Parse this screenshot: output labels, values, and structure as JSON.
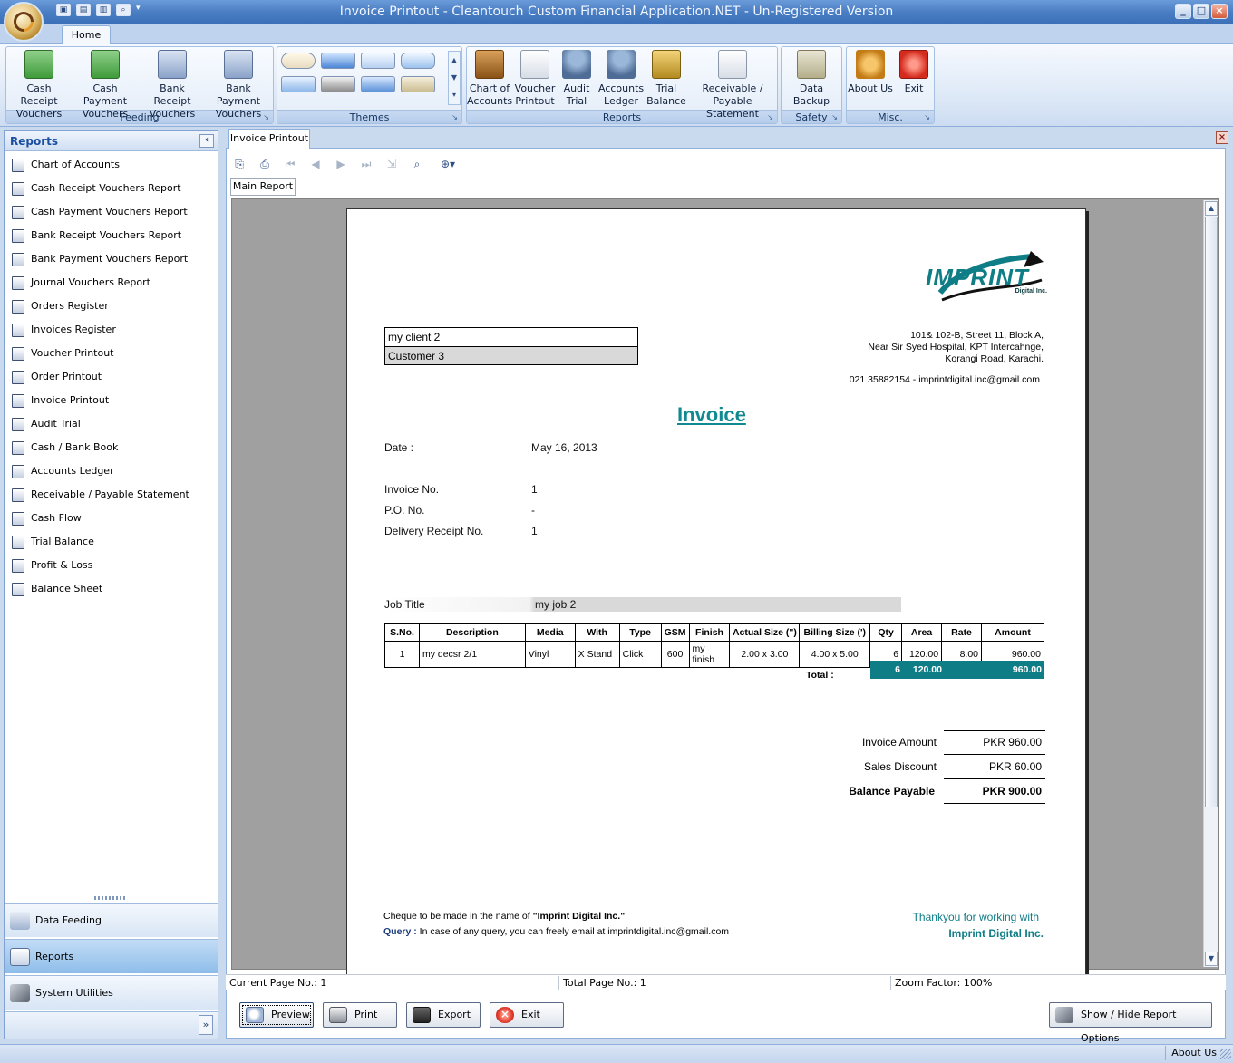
{
  "window": {
    "title": "Invoice Printout - Cleantouch Custom Financial Application.NET - Un-Registered Version",
    "qat_icons": [
      "qat-icon-1",
      "qat-icon-2",
      "qat-icon-3",
      "qat-icon-4"
    ],
    "minimize": "_",
    "maximize": "□",
    "close": "×"
  },
  "ribbon": {
    "tab_home": "Home",
    "groups": {
      "feeding": "Feeding",
      "themes": "Themes",
      "reports": "Reports",
      "safety": "Safety",
      "misc": "Misc."
    },
    "buttons": {
      "cash_receipt_1": "Cash Receipt",
      "cash_receipt_2": "Vouchers",
      "cash_payment_1": "Cash Payment",
      "cash_payment_2": "Vouchers",
      "bank_receipt_1": "Bank Receipt",
      "bank_receipt_2": "Vouchers",
      "bank_payment_1": "Bank Payment",
      "bank_payment_2": "Vouchers",
      "chart_1": "Chart of",
      "chart_2": "Accounts",
      "voucher_1": "Voucher",
      "voucher_2": "Printout",
      "audit_1": "Audit",
      "audit_2": "Trial",
      "ledger_1": "Accounts",
      "ledger_2": "Ledger",
      "trial_1": "Trial",
      "trial_2": "Balance",
      "recv_1": "Receivable /",
      "recv_2": "Payable Statement",
      "backup": "Data Backup",
      "about": "About Us",
      "exit": "Exit"
    }
  },
  "leftpane": {
    "header": "Reports",
    "collapse_icon": "‹",
    "items": [
      "Chart of Accounts",
      "Cash Receipt Vouchers Report",
      "Cash Payment Vouchers Report",
      "Bank Receipt Vouchers Report",
      "Bank Payment Vouchers Report",
      "Journal Vouchers Report",
      "Orders Register",
      "Invoices Register",
      "Voucher Printout",
      "Order Printout",
      "Invoice Printout",
      "Audit Trial",
      "Cash / Bank Book",
      "Accounts Ledger",
      "Receivable / Payable Statement",
      "Cash Flow",
      "Trial Balance",
      "Profit & Loss",
      "Balance Sheet"
    ],
    "nav": {
      "data_feeding": "Data Feeding",
      "reports": "Reports",
      "system_utilities": "System Utilities",
      "more": "»"
    }
  },
  "document": {
    "tab": "Invoice Printout",
    "close": "×",
    "main_report_tab": "Main Report"
  },
  "invoice": {
    "logo": "IMPRINT",
    "logo_sub": "Digital Inc.",
    "address_1": "101& 102-B, Street 11, Block A,",
    "address_2": "Near Sir Syed Hospital, KPT Intercahnge,",
    "address_3": "Korangi Road, Karachi.",
    "contact": "021 35882154 - imprintdigital.inc@gmail.com",
    "client": "my client 2",
    "customer": "Customer 3",
    "title": "Invoice",
    "date_label": "Date :",
    "date_value": "May 16, 2013",
    "invoice_no_label": "Invoice No.",
    "invoice_no_value": "1",
    "po_label": "P.O. No.",
    "po_value": "-",
    "delivery_label": "Delivery Receipt No.",
    "delivery_value": "1",
    "job_title_label": "Job Title",
    "job_title_value": "my job 2",
    "columns": [
      "S.No.",
      "Description",
      "Media",
      "With",
      "Type",
      "GSM",
      "Finish",
      "Actual Size (\")",
      "Billing Size (')",
      "Qty",
      "Area",
      "Rate",
      "Amount"
    ],
    "rows": [
      [
        "1",
        "my decsr 2/1",
        "Vinyl",
        "X Stand",
        "Click",
        "600",
        "my finish",
        "2.00 x 3.00",
        "4.00 x 5.00",
        "6",
        "120.00",
        "8.00",
        "960.00"
      ]
    ],
    "total_label": "Total :",
    "total_qty": "6",
    "total_area": "120.00",
    "total_amount": "960.00",
    "invoice_amount_label": "Invoice Amount",
    "invoice_amount_value": "PKR 960.00",
    "sales_discount_label": "Sales Discount",
    "sales_discount_value": "PKR 60.00",
    "balance_label": "Balance Payable",
    "balance_value": "PKR 900.00",
    "cheque_note_prefix": "Cheque to be made in the name of ",
    "cheque_note_name": "\"Imprint Digital Inc.\"",
    "query_label": "Query :",
    "query_text": " In case of any query, you can freely email at imprintdigital.inc@gmail.com",
    "thanks_1": "Thankyou for working with",
    "thanks_2": "Imprint Digital Inc."
  },
  "statusbar": {
    "current_page": "Current Page No.: 1",
    "total_page": "Total Page No.: 1",
    "zoom": "Zoom Factor: 100%"
  },
  "bottom_buttons": {
    "preview": "Preview",
    "print": "Print",
    "export": "Export",
    "exit": "Exit",
    "show_hide": "Show / Hide Report Options"
  },
  "app_status": {
    "about": "About Us"
  },
  "colors": {
    "accent": "#0f7d86",
    "ribbon_blue": "#bfd3ee",
    "title_blue": "#4b7fc4"
  }
}
